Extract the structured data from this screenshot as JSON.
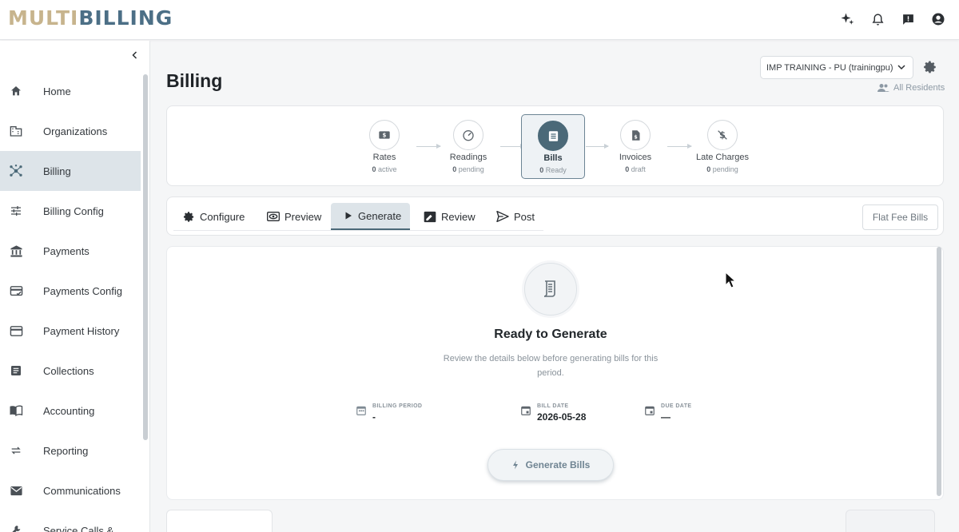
{
  "app": {
    "logo_part1": "MULTI",
    "logo_part2": "BILLING"
  },
  "colors": {
    "accent": "#4b6978",
    "logo_gold": "#c7b48d",
    "logo_blue": "#4c6f86",
    "active_bg": "#dde4e9"
  },
  "topbar": {
    "icons": [
      "sparkle-icon",
      "bell-icon",
      "feedback-icon",
      "account-icon"
    ]
  },
  "sidebar": {
    "items": [
      {
        "label": "Home",
        "icon": "home-icon"
      },
      {
        "label": "Organizations",
        "icon": "building-icon"
      },
      {
        "label": "Billing",
        "icon": "hub-icon",
        "active": true
      },
      {
        "label": "Billing Config",
        "icon": "sliders-icon"
      },
      {
        "label": "Payments",
        "icon": "bank-icon"
      },
      {
        "label": "Payments Config",
        "icon": "card-check-icon"
      },
      {
        "label": "Payment History",
        "icon": "card-icon"
      },
      {
        "label": "Collections",
        "icon": "list-icon"
      },
      {
        "label": "Accounting",
        "icon": "book-icon"
      },
      {
        "label": "Reporting",
        "icon": "swap-icon"
      },
      {
        "label": "Communications",
        "icon": "mail-icon"
      },
      {
        "label": "Service Calls &",
        "icon": "wrench-icon"
      }
    ]
  },
  "header": {
    "title": "Billing",
    "org_select": "IMP TRAINING - PU (trainingpu)",
    "residents_label": "All Residents"
  },
  "stepper": [
    {
      "label": "Rates",
      "count": "0",
      "status": "active",
      "icon": "money-icon"
    },
    {
      "label": "Readings",
      "count": "0",
      "status": "pending",
      "icon": "gauge-icon"
    },
    {
      "label": "Bills",
      "count": "0",
      "status": "Ready",
      "icon": "document-icon",
      "active": true
    },
    {
      "label": "Invoices",
      "count": "0",
      "status": "draft",
      "icon": "invoice-icon"
    },
    {
      "label": "Late Charges",
      "count": "0",
      "status": "pending",
      "icon": "no-dollar-icon"
    }
  ],
  "tabs": [
    {
      "label": "Configure",
      "icon": "gear-icon"
    },
    {
      "label": "Preview",
      "icon": "eye-icon"
    },
    {
      "label": "Generate",
      "icon": "play-icon",
      "active": true
    },
    {
      "label": "Review",
      "icon": "review-icon"
    },
    {
      "label": "Post",
      "icon": "send-icon"
    }
  ],
  "flat_fee_button": "Flat Fee Bills",
  "generate": {
    "title": "Ready to Generate",
    "description": "Review the details below before generating bills for this period.",
    "billing_period_label": "BILLING PERIOD",
    "billing_period_value": "-",
    "bill_date_label": "BILL DATE",
    "bill_date_value": "2026-05-28",
    "due_date_label": "DUE DATE",
    "due_date_value": "—",
    "button_label": "Generate Bills"
  }
}
